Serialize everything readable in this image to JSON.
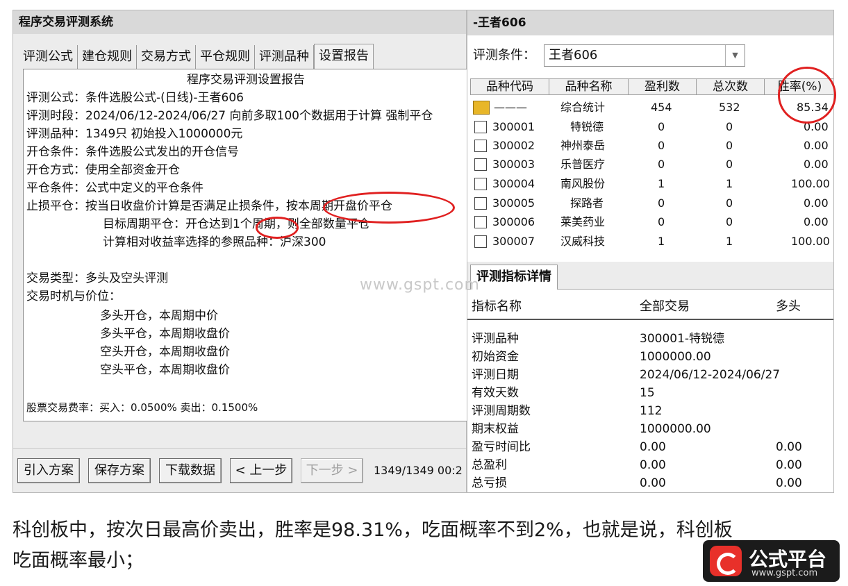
{
  "left": {
    "title": "程序交易评测系统",
    "tabs": [
      "评测公式",
      "建仓规则",
      "交易方式",
      "平仓规则",
      "评测品种",
      "设置报告"
    ],
    "report": {
      "title": "程序交易评测设置报告",
      "lines": [
        "评测公式：条件选股公式-(日线)-王者606",
        "评测时段：2024/06/12-2024/06/27 向前多取100个数据用于计算 强制平仓",
        "评测品种：1349只 初始投入1000000元",
        "开仓条件：条件选股公式发出的开仓信号",
        "开仓方式：使用全部资金开仓",
        "平仓条件：公式中定义的平仓条件",
        "止损平仓：按当日收盘价计算是否满足止损条件，按本周期开盘价平仓",
        "目标周期平仓：开仓达到1个周期，则全部数量平仓",
        "计算相对收益率选择的参照品种：沪深300",
        "交易类型：多头及空头评测",
        "交易时机与价位：",
        "多头开仓，本周期中价",
        "多头平仓，本周期收盘价",
        "空头开仓，本周期收盘价",
        "空头平仓，本周期收盘价",
        "股票交易费率：买入：0.0500% 卖出：0.1500%"
      ]
    },
    "buttons": {
      "import": "引入方案",
      "save": "保存方案",
      "download": "下载数据",
      "prev": "< 上一步",
      "next": "下一步 >"
    },
    "progress": "1349/1349 00:2"
  },
  "right": {
    "title": "-王者606",
    "condition_label": "评测条件：",
    "condition_value": "王者606",
    "grid": {
      "headers": [
        "品种代码",
        "品种名称",
        "盈利数",
        "总次数",
        "胜率(%)"
      ],
      "summary": {
        "code": "———",
        "name": "综合统计",
        "wins": "454",
        "total": "532",
        "rate": "85.34"
      },
      "rows": [
        {
          "code": "300001",
          "name": "特锐德",
          "wins": "0",
          "total": "0",
          "rate": "0.00"
        },
        {
          "code": "300002",
          "name": "神州泰岳",
          "wins": "0",
          "total": "0",
          "rate": "0.00"
        },
        {
          "code": "300003",
          "name": "乐普医疗",
          "wins": "0",
          "total": "0",
          "rate": "0.00"
        },
        {
          "code": "300004",
          "name": "南风股份",
          "wins": "1",
          "total": "1",
          "rate": "100.00"
        },
        {
          "code": "300005",
          "name": "探路者",
          "wins": "0",
          "total": "0",
          "rate": "0.00"
        },
        {
          "code": "300006",
          "name": "莱美药业",
          "wins": "0",
          "total": "0",
          "rate": "0.00"
        },
        {
          "code": "300007",
          "name": "汉威科技",
          "wins": "1",
          "total": "1",
          "rate": "100.00"
        }
      ]
    },
    "detail": {
      "tab": "评测指标详情",
      "headers": [
        "指标名称",
        "全部交易",
        "多头"
      ],
      "rows": [
        {
          "name": "评测品种",
          "all": "300001-特锐德",
          "long": ""
        },
        {
          "name": "初始资金",
          "all": "1000000.00",
          "long": ""
        },
        {
          "name": "评测日期",
          "all": "2024/06/12-2024/06/27",
          "long": ""
        },
        {
          "name": "有效天数",
          "all": "15",
          "long": ""
        },
        {
          "name": "评测周期数",
          "all": "112",
          "long": ""
        },
        {
          "name": "期末权益",
          "all": "1000000.00",
          "long": ""
        },
        {
          "name": "盈亏时间比",
          "all": "0.00",
          "long": "0.00"
        },
        {
          "name": "总盈利",
          "all": "0.00",
          "long": "0.00"
        },
        {
          "name": "总亏损",
          "all": "0.00",
          "long": "0.00"
        }
      ]
    }
  },
  "watermark": "www.gspt.com",
  "caption": {
    "line1": "科创板中，按次日最高价卖出，胜率是98.31%，吃面概率不到2%，也就是说，科创板",
    "line2": "吃面概率最小；"
  },
  "logo": {
    "name": "公式平台",
    "url": "www.gspt.com"
  },
  "colors": {
    "annotation": "#e02020",
    "logo_red": "#e8302a",
    "icon_yellow": "#e8b628"
  }
}
